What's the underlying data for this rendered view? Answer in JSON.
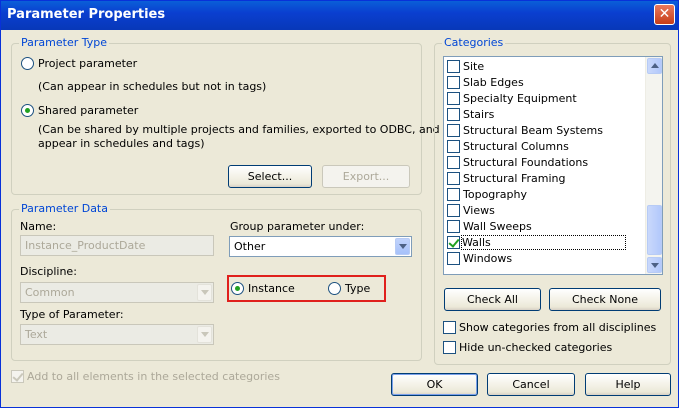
{
  "window": {
    "title": "Parameter Properties",
    "close_glyph": "✕"
  },
  "parameter_type": {
    "legend": "Parameter Type",
    "project": {
      "label": "Project parameter",
      "description": "(Can appear in schedules but not in tags)",
      "selected": false
    },
    "shared": {
      "label": "Shared parameter",
      "description_line1": "(Can be shared by multiple projects and families, exported to ODBC, and",
      "description_line2": "appear in schedules and tags)",
      "selected": true
    },
    "select_button": "Select...",
    "export_button": "Export..."
  },
  "parameter_data": {
    "legend": "Parameter Data",
    "name_label": "Name:",
    "name_value": "Instance_ProductDate",
    "discipline_label": "Discipline:",
    "discipline_value": "Common",
    "type_label": "Type of Parameter:",
    "type_value": "Text",
    "group_label": "Group parameter under:",
    "group_value": "Other",
    "instance_label": "Instance",
    "type_radio_label": "Type",
    "instance_selected": true
  },
  "add_to_all": {
    "label": "Add to all elements in the selected categories",
    "checked": true
  },
  "categories": {
    "legend": "Categories",
    "items": [
      {
        "label": "Site",
        "checked": false
      },
      {
        "label": "Slab Edges",
        "checked": false
      },
      {
        "label": "Specialty Equipment",
        "checked": false
      },
      {
        "label": "Stairs",
        "checked": false
      },
      {
        "label": "Structural Beam Systems",
        "checked": false
      },
      {
        "label": "Structural Columns",
        "checked": false
      },
      {
        "label": "Structural Foundations",
        "checked": false
      },
      {
        "label": "Structural Framing",
        "checked": false
      },
      {
        "label": "Topography",
        "checked": false
      },
      {
        "label": "Views",
        "checked": false
      },
      {
        "label": "Wall Sweeps",
        "checked": false
      },
      {
        "label": "Walls",
        "checked": true
      },
      {
        "label": "Windows",
        "checked": false
      }
    ],
    "check_all_button": "Check All",
    "check_none_button": "Check None",
    "show_all_disciplines": {
      "label": "Show categories from all disciplines",
      "checked": false
    },
    "hide_unchecked": {
      "label": "Hide un-checked categories",
      "checked": false
    }
  },
  "buttons": {
    "ok": "OK",
    "cancel": "Cancel",
    "help": "Help"
  },
  "colors": {
    "accent": "#0a3fd0",
    "highlight_box": "#e0201c",
    "radio_dot": "#21a121"
  }
}
